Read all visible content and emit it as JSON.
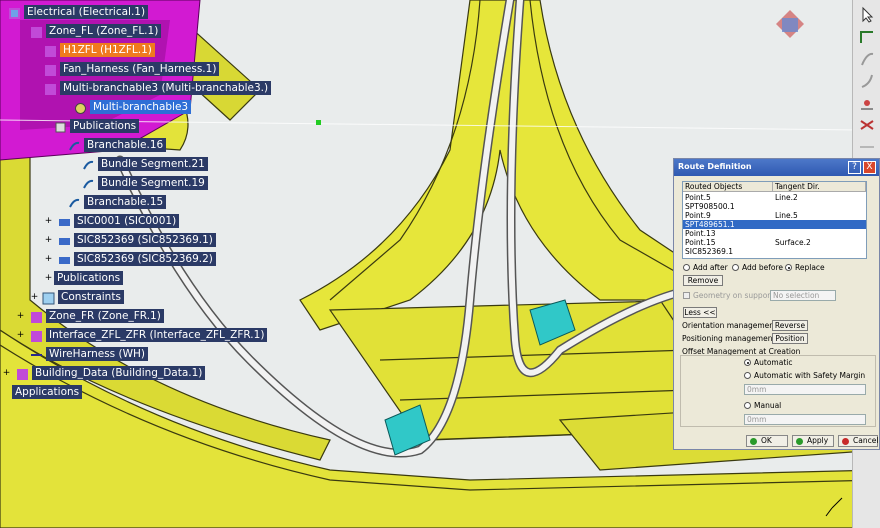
{
  "tree": [
    {
      "id": "electrical",
      "label": "Electrical (Electrical.1)",
      "style": "normal"
    },
    {
      "id": "zone-fl",
      "label": "Zone_FL (Zone_FL.1)",
      "style": "normal"
    },
    {
      "id": "h1zfl",
      "label": "H1ZFL (H1ZFL.1)",
      "style": "orange"
    },
    {
      "id": "fan-harness",
      "label": "Fan_Harness (Fan_Harness.1)",
      "style": "normal"
    },
    {
      "id": "multi-branchable",
      "label": "Multi-branchable3 (Multi-branchable3.)",
      "style": "normal"
    },
    {
      "id": "multi-branchable-sel",
      "label": "Multi-branchable3",
      "style": "blue"
    },
    {
      "id": "publications-1",
      "label": "Publications",
      "style": "normal"
    },
    {
      "id": "branchable-16",
      "label": "Branchable.16",
      "style": "normal"
    },
    {
      "id": "bundle-21",
      "label": "Bundle Segment.21",
      "style": "normal"
    },
    {
      "id": "bundle-19",
      "label": "Bundle Segment.19",
      "style": "normal"
    },
    {
      "id": "branchable-15",
      "label": "Branchable.15",
      "style": "normal"
    },
    {
      "id": "sic0001",
      "label": "SIC0001 (SIC0001)",
      "style": "normal"
    },
    {
      "id": "sic852369-1",
      "label": "SIC852369 (SIC852369.1)",
      "style": "normal"
    },
    {
      "id": "sic852369-2",
      "label": "SIC852369 (SIC852369.2)",
      "style": "normal"
    },
    {
      "id": "publications-2",
      "label": "Publications",
      "style": "normal"
    },
    {
      "id": "constraints",
      "label": "Constraints",
      "style": "normal"
    },
    {
      "id": "zone-fr",
      "label": "Zone_FR (Zone_FR.1)",
      "style": "normal"
    },
    {
      "id": "interface",
      "label": "Interface_ZFL_ZFR (Interface_ZFL_ZFR.1)",
      "style": "normal"
    },
    {
      "id": "wireharness",
      "label": "WireHarness (WH)",
      "style": "normal"
    },
    {
      "id": "building-data",
      "label": "Building_Data (Building_Data.1)",
      "style": "normal"
    },
    {
      "id": "applications",
      "label": "Applications",
      "style": "normal"
    }
  ],
  "dialog": {
    "title": "Route Definition",
    "help_label": "?",
    "close_label": "X",
    "col_routed": "Routed Objects",
    "col_tangent": "Tangent Dir.",
    "rows": [
      {
        "obj": "Point.5",
        "tan": "Line.2"
      },
      {
        "obj": "SPT908500.1",
        "tan": ""
      },
      {
        "obj": "Point.9",
        "tan": "Line.5"
      },
      {
        "obj": "SPT489651.1",
        "tan": ""
      },
      {
        "obj": "Point.13",
        "tan": ""
      },
      {
        "obj": "Point.15",
        "tan": "Surface.2"
      },
      {
        "obj": "SIC852369.1",
        "tan": ""
      }
    ],
    "selected_row": 3,
    "add_after": "Add after",
    "add_before": "Add before",
    "replace": "Replace",
    "add_mode": "replace",
    "remove_label": "Remove",
    "geometry_on_support": "Geometry on support",
    "no_selection": "No selection",
    "less_label": "Less <<",
    "orientation_label": "Orientation management:",
    "reverse_label": "Reverse",
    "positioning_label": "Positioning management:",
    "position_label": "Position",
    "offset_title": "Offset Management at Creation",
    "automatic": "Automatic",
    "automatic_safety": "Automatic with Safety Margin",
    "manual": "Manual",
    "offset_mode": "automatic",
    "field_value_1": "0mm",
    "field_value_2": "0mm",
    "ok_label": "OK",
    "apply_label": "Apply",
    "cancel_label": "Cancel"
  },
  "colors": {
    "model_yellow": "#e8e83a",
    "background": "#e9ecec",
    "tree_label_bg": "#2b3a66",
    "selected_orange": "#f07a1e",
    "selected_blue": "#2f6fd6",
    "connector_cyan": "#30c8c8",
    "cable_white": "#f2f2f2",
    "magenta_part": "#d21ad2"
  }
}
